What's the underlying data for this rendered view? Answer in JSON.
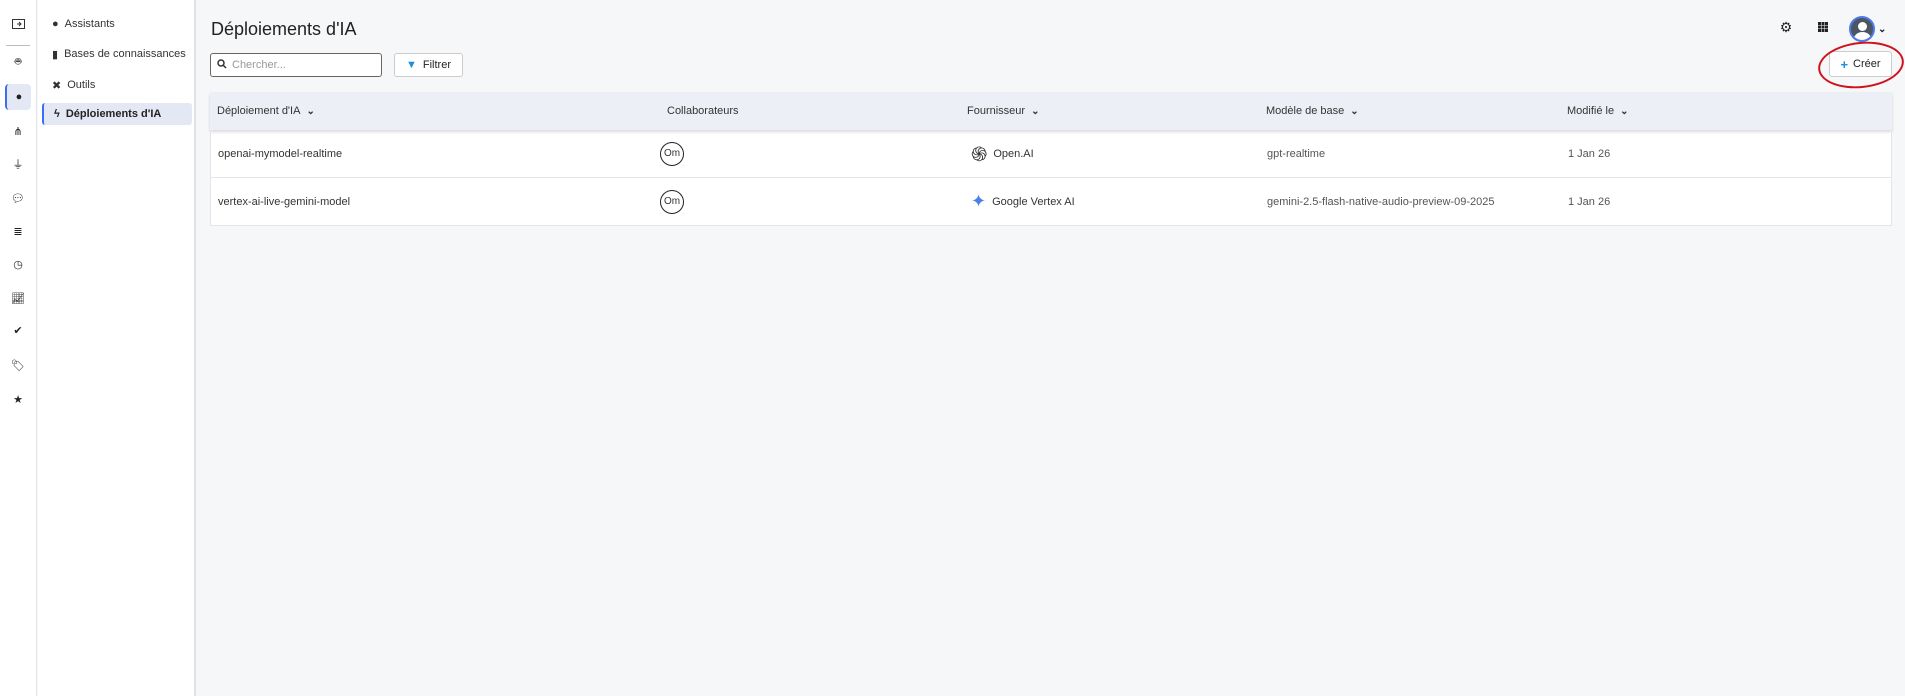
{
  "rail": {
    "icons": [
      "panel-toggle-icon",
      "robot-icon",
      "brain-icon",
      "sitemap-icon",
      "plug-icon",
      "comments-icon",
      "database-icon",
      "clock-icon",
      "chart-line-icon",
      "check-circle-icon",
      "tag-icon",
      "star-icon"
    ]
  },
  "sidebar": {
    "items": [
      {
        "label": "Assistants",
        "icon": "brain-icon"
      },
      {
        "label": "Bases de connaissances",
        "icon": "book-icon"
      },
      {
        "label": "Outils",
        "icon": "tools-icon"
      },
      {
        "label": "Déploiements d'IA",
        "icon": "bolt-icon",
        "active": true
      }
    ]
  },
  "header": {
    "title": "Déploiements d'IA"
  },
  "toolbar": {
    "search_placeholder": "Chercher...",
    "filter_label": "Filtrer",
    "create_label": "Créer"
  },
  "table": {
    "columns": [
      "Déploiement d'IA",
      "Collaborateurs",
      "Fournisseur",
      "Modèle de base",
      "Modifié le"
    ],
    "rows": [
      {
        "name": "openai-mymodel-realtime",
        "collaborator": "Om",
        "provider": "Open.AI",
        "model": "gpt-realtime",
        "modified": "1 Jan 26"
      },
      {
        "name": "vertex-ai-live-gemini-model",
        "collaborator": "Om",
        "provider": "Google Vertex AI",
        "model": "gemini-2.5-flash-native-audio-preview-09-2025",
        "modified": "1 Jan 26"
      }
    ]
  },
  "colors": {
    "accent": "#3b6ef5",
    "highlight": "#d0121b"
  }
}
